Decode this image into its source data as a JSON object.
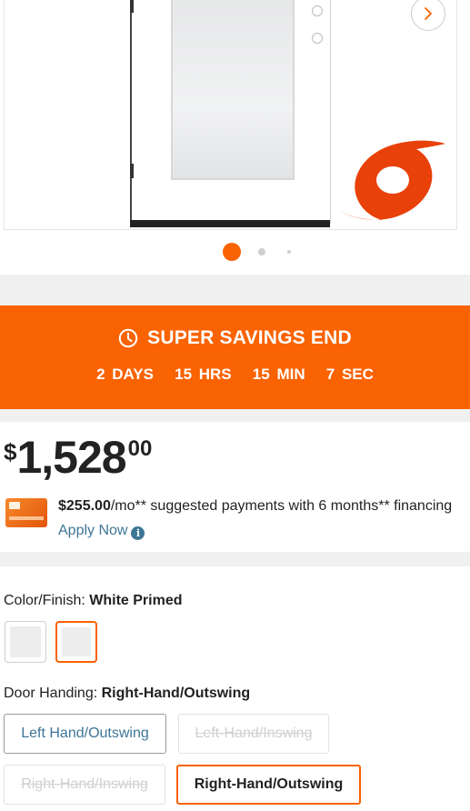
{
  "gallery": {
    "next_icon": "chevron-right-icon",
    "badge_icon": "hurricane-icon",
    "dots": 3,
    "active_dot": 1
  },
  "promo": {
    "icon": "clock-icon",
    "title": "SUPER SAVINGS END",
    "timer": "2 DAYS   15 HRS   15 MIN   7 SEC",
    "background": "#f96302"
  },
  "price": {
    "currency": "$",
    "whole": "1,528",
    "cents": "00"
  },
  "financing": {
    "amount": "$255.00",
    "text": "/mo** suggested payments with 6 months** financing ",
    "link": "Apply Now",
    "info_icon": "info-icon"
  },
  "color_option": {
    "label": "Color/Finish: ",
    "value": "White Primed",
    "swatch_count": 2,
    "selected_index": 2
  },
  "handing_option": {
    "label": "Door Handing: ",
    "value": "Right-Hand/Outswing",
    "buttons": [
      {
        "label": "Left Hand/Outswing",
        "state": "available"
      },
      {
        "label": "Left-Hand/Inswing",
        "state": "unavailable"
      },
      {
        "label": "Right-Hand/Inswing",
        "state": "unavailable"
      },
      {
        "label": "Right-Hand/Outswing",
        "state": "selected"
      }
    ]
  },
  "colors": {
    "accent": "#f96302",
    "link": "#3e7697",
    "band": "#f0f0f0"
  }
}
